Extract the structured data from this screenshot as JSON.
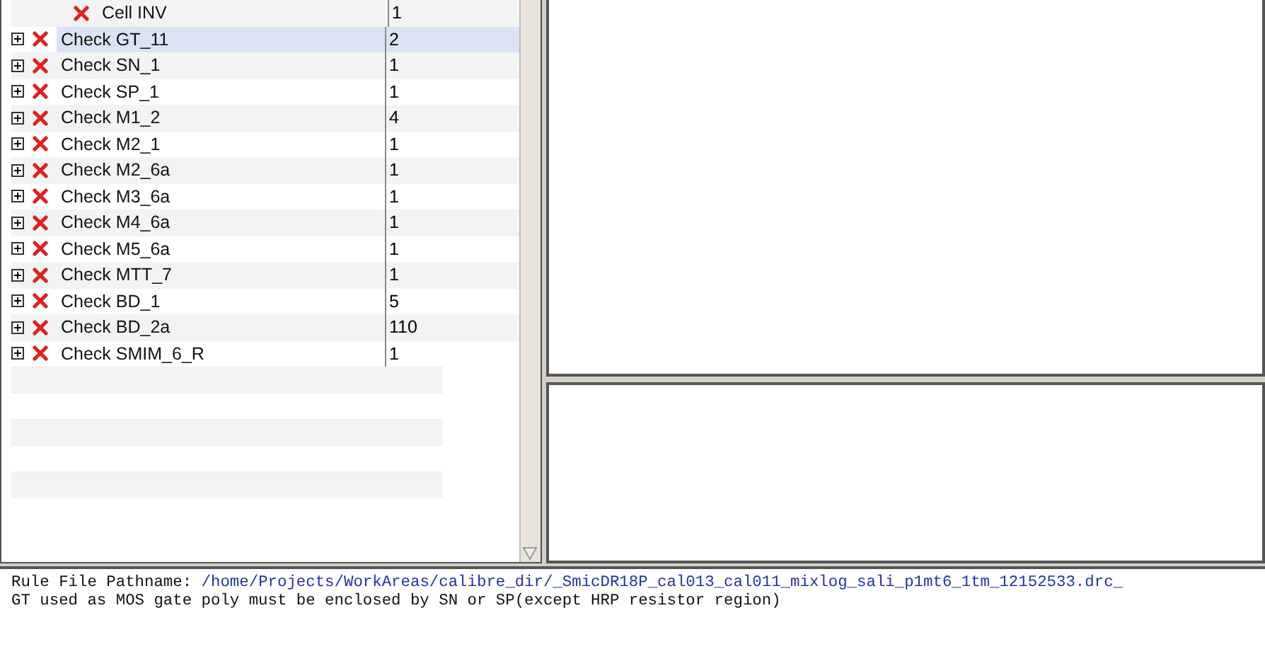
{
  "results_tree": {
    "rows": [
      {
        "kind": "cell",
        "label": "Cell INV",
        "count": "1",
        "selected": false
      },
      {
        "kind": "check",
        "label": "Check GT_11",
        "count": "2",
        "selected": true,
        "expanded": false
      },
      {
        "kind": "check",
        "label": "Check SN_1",
        "count": "1",
        "selected": false,
        "expanded": false
      },
      {
        "kind": "check",
        "label": "Check SP_1",
        "count": "1",
        "selected": false,
        "expanded": false
      },
      {
        "kind": "check",
        "label": "Check M1_2",
        "count": "4",
        "selected": false,
        "expanded": false
      },
      {
        "kind": "check",
        "label": "Check M2_1",
        "count": "1",
        "selected": false,
        "expanded": false
      },
      {
        "kind": "check",
        "label": "Check M2_6a",
        "count": "1",
        "selected": false,
        "expanded": false
      },
      {
        "kind": "check",
        "label": "Check M3_6a",
        "count": "1",
        "selected": false,
        "expanded": false
      },
      {
        "kind": "check",
        "label": "Check M4_6a",
        "count": "1",
        "selected": false,
        "expanded": false
      },
      {
        "kind": "check",
        "label": "Check M5_6a",
        "count": "1",
        "selected": false,
        "expanded": false
      },
      {
        "kind": "check",
        "label": "Check MTT_7",
        "count": "1",
        "selected": false,
        "expanded": false
      },
      {
        "kind": "check",
        "label": "Check BD_1",
        "count": "5",
        "selected": false,
        "expanded": false
      },
      {
        "kind": "check",
        "label": "Check BD_2a",
        "count": "110",
        "selected": false,
        "expanded": false
      },
      {
        "kind": "check",
        "label": "Check SMIM_6_R",
        "count": "1",
        "selected": false,
        "expanded": false
      }
    ]
  },
  "rule_info": {
    "pathname_label": "Rule File Pathname:",
    "pathname": "/home/Projects/WorkAreas/calibre_dir/_SmicDR18P_cal013_cal011_mixlog_sali_p1mt6_1tm_12152533.drc_",
    "description": "GT used as MOS gate poly must be enclosed by SN or SP(except HRP resistor region)"
  }
}
